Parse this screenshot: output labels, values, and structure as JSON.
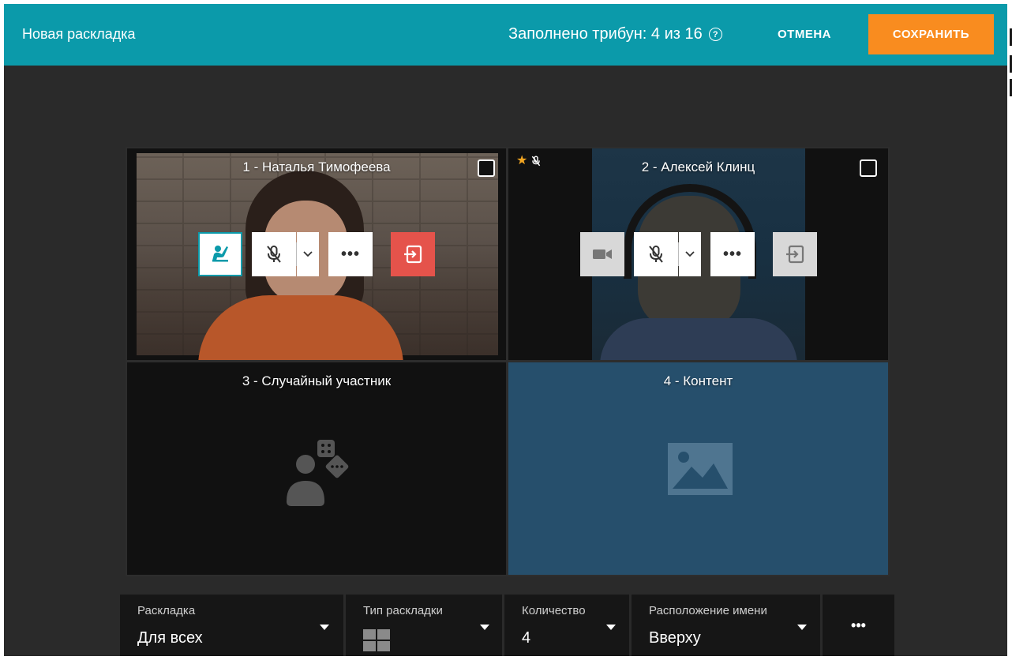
{
  "header": {
    "title": "Новая раскладка",
    "filled_label": "Заполнено трибун: 4 из 16",
    "cancel_label": "ОТМЕНА",
    "save_label": "СОХРАНИТЬ"
  },
  "cells": [
    {
      "label": "1 - Наталья Тимофеева",
      "checked": false
    },
    {
      "label": "2 - Алексей Клинц",
      "checked": false,
      "flags": [
        "star-icon",
        "mic-off-icon"
      ]
    },
    {
      "label": "3 - Случайный участник"
    },
    {
      "label": "4 - Контент"
    }
  ],
  "bottom": {
    "layout_label": "Раскладка",
    "layout_value": "Для всех",
    "type_label": "Тип раскладки",
    "count_label": "Количество",
    "count_value": "4",
    "name_pos_label": "Расположение имени",
    "name_pos_value": "Вверху",
    "more": "•••"
  },
  "colors": {
    "header": "#0b9aaa",
    "save": "#f98c1f",
    "leave": "#e5534b",
    "content_tile": "#264f6c"
  }
}
